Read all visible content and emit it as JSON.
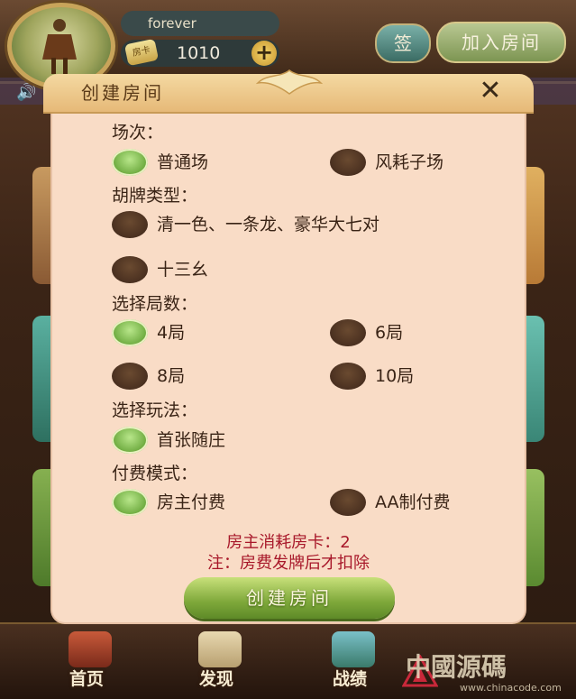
{
  "header": {
    "username": "forever",
    "card_icon_text": "房卡",
    "card_count": "1010",
    "plus_label": "+",
    "sign_label": "签",
    "join_room_label": "加入房间"
  },
  "dialog": {
    "title": "创建房间",
    "close_label": "✕",
    "sections": {
      "round_type": {
        "label": "场次：",
        "options": [
          {
            "label": "普通场",
            "selected": true
          },
          {
            "label": "风耗子场",
            "selected": false
          }
        ]
      },
      "hu_type": {
        "label": "胡牌类型：",
        "options": [
          {
            "label": "清一色、一条龙、豪华大七对",
            "selected": false
          },
          {
            "label": "十三幺",
            "selected": false
          }
        ]
      },
      "rounds": {
        "label": "选择局数：",
        "options": [
          {
            "label": "4局",
            "selected": true
          },
          {
            "label": "6局",
            "selected": false
          },
          {
            "label": "8局",
            "selected": false
          },
          {
            "label": "10局",
            "selected": false
          }
        ]
      },
      "play_mode": {
        "label": "选择玩法：",
        "options": [
          {
            "label": "首张随庄",
            "selected": true
          }
        ]
      },
      "payment": {
        "label": "付费模式：",
        "options": [
          {
            "label": "房主付费",
            "selected": true
          },
          {
            "label": "AA制付费",
            "selected": false
          }
        ]
      }
    },
    "cost_note": "房主消耗房卡：2",
    "deduct_note": "注：房费发牌后才扣除",
    "create_button": "创建房间"
  },
  "bottom_nav": {
    "items": [
      {
        "label": "首页",
        "icon": "home-icon"
      },
      {
        "label": "发现",
        "icon": "discover-icon"
      },
      {
        "label": "战绩",
        "icon": "record-icon"
      }
    ]
  },
  "watermark": {
    "text": "中國源碼",
    "url": "www.chinacode.com"
  },
  "colors": {
    "selected_radio": "#7ab84a",
    "unselected_radio": "#4a3020",
    "note_red": "#a8182a",
    "dialog_bg": "#f9dcc6"
  }
}
